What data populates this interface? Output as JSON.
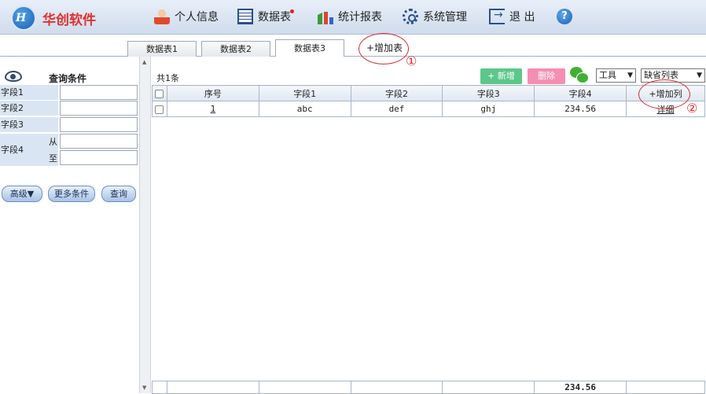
{
  "header": {
    "brand": "华创软件",
    "logo_text": "H",
    "nav": [
      {
        "label": "个人信息",
        "icon": "user-icon"
      },
      {
        "label": "数据表",
        "icon": "table-icon",
        "badge_color": "#e02020"
      },
      {
        "label": "统计报表",
        "icon": "chart-icon"
      },
      {
        "label": "系统管理",
        "icon": "gear-icon"
      },
      {
        "label": "退 出",
        "icon": "exit-icon"
      },
      {
        "label": "?",
        "icon": "help-icon"
      }
    ]
  },
  "tabs": [
    {
      "label": "数据表1",
      "active": false
    },
    {
      "label": "数据表2",
      "active": false
    },
    {
      "label": "数据表3",
      "active": true
    }
  ],
  "add_table_label": "+增加表",
  "annotations": {
    "one": "①",
    "two": "②",
    "color": "#d92c2c"
  },
  "sidebar": {
    "title": "查询条件",
    "fields": [
      "字段1",
      "字段2",
      "字段3",
      "字段4"
    ],
    "range_from": "从",
    "range_to": "至",
    "buttons": {
      "advanced": "高级▼",
      "more": "更多条件",
      "query": "查询"
    }
  },
  "toolbar": {
    "count": "共1条",
    "add": "+ 新增",
    "delete": "删除",
    "tools": "工具",
    "list_view": "缺省列表",
    "add_color": "#5cc78a",
    "delete_color": "#f48fb1"
  },
  "table": {
    "headers": [
      "序号",
      "字段1",
      "字段2",
      "字段3",
      "字段4",
      "+增加列"
    ],
    "rows": [
      {
        "seq": "1",
        "f1": "abc",
        "f2": "def",
        "f3": "ghj",
        "f4": "234.56",
        "action": "详细"
      }
    ],
    "total_f4": "234.56"
  }
}
